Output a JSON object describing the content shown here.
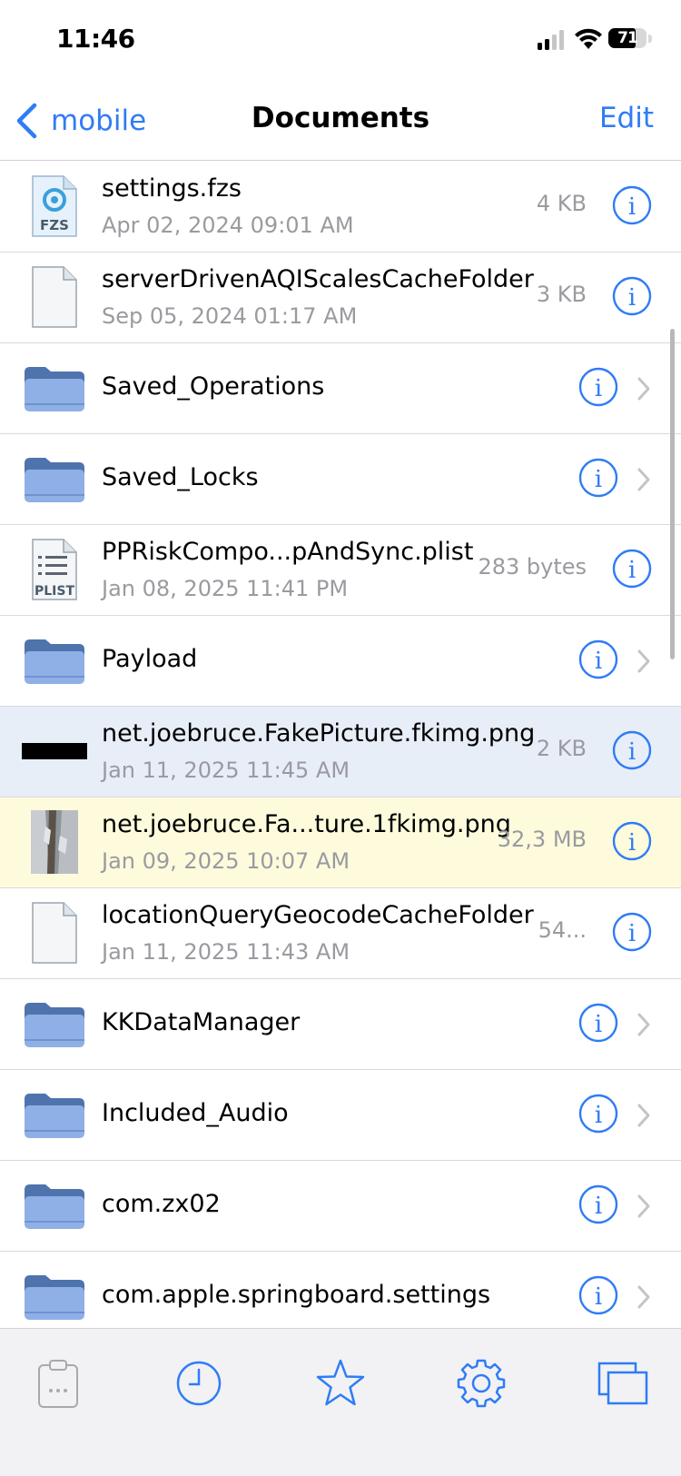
{
  "status_bar": {
    "time": "11:46",
    "battery_level": "71"
  },
  "nav": {
    "back_label": "mobile",
    "title": "Documents",
    "edit_label": "Edit"
  },
  "colors": {
    "accent": "#2f7cf6",
    "folder": "#8fb0e6",
    "selected_row": "#e8eef8",
    "highlight_row": "#fdfbdc"
  },
  "files": [
    {
      "name": "settings.fzs",
      "date": "Apr 02, 2024 09:01 AM",
      "size": "4 KB",
      "icon": "fzs-file-icon",
      "badge": "FZS"
    },
    {
      "name": "serverDrivenAQIScalesCacheFolder",
      "date": "Sep 05, 2024 01:17 AM",
      "size": "3 KB",
      "icon": "blank-file-icon"
    },
    {
      "name": "Saved_Operations",
      "icon": "folder-icon"
    },
    {
      "name": "Saved_Locks",
      "icon": "folder-icon"
    },
    {
      "name": "PPRiskCompo...pAndSync.plist",
      "date": "Jan 08, 2025 11:41 PM",
      "size": "283 bytes",
      "icon": "plist-file-icon",
      "badge": "PLIST"
    },
    {
      "name": "Payload",
      "icon": "folder-icon"
    },
    {
      "name": "net.joebruce.FakePicture.fkimg.png",
      "date": "Jan 11, 2025 11:45 AM",
      "size": "2 KB",
      "icon": "image-thumbnail-black"
    },
    {
      "name": "net.joebruce.Fa...ture.1fkimg.png",
      "date": "Jan 09, 2025 10:07 AM",
      "size": "32,3 MB",
      "icon": "image-thumbnail-photo"
    },
    {
      "name": "locationQueryGeocodeCacheFolder",
      "date": "Jan 11, 2025 11:43 AM",
      "size": "54...",
      "icon": "blank-file-icon"
    },
    {
      "name": "KKDataManager",
      "icon": "folder-icon"
    },
    {
      "name": "Included_Audio",
      "icon": "folder-icon"
    },
    {
      "name": "com.zx02",
      "icon": "folder-icon"
    },
    {
      "name": "com.apple.springboard.settings",
      "icon": "folder-icon"
    }
  ],
  "tab_bar": {
    "tabs": [
      "clipboard-icon",
      "clock-icon",
      "star-icon",
      "gear-icon",
      "windows-icon"
    ]
  }
}
